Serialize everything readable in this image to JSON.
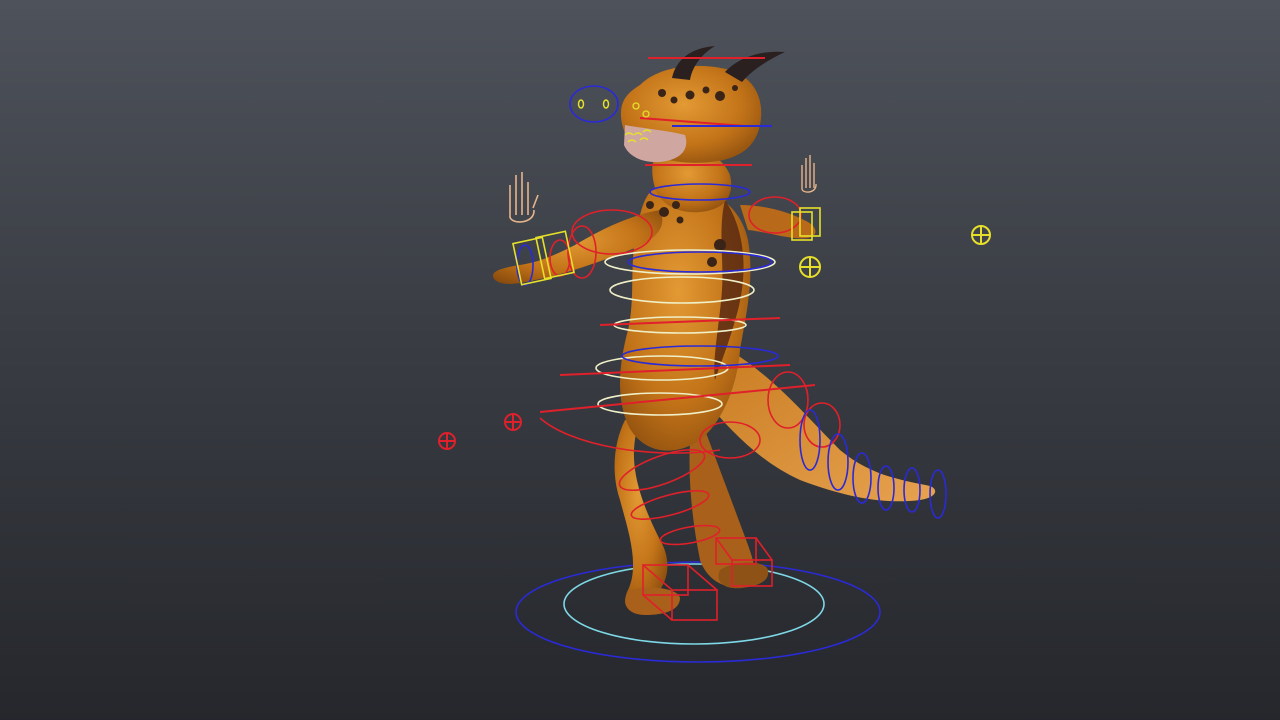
{
  "viewport": {
    "background_top": "#4e525a",
    "background_bottom": "#25272c"
  },
  "character": {
    "skin_color": "#c97a1c",
    "spot_color": "#3a2418",
    "horn_color": "#2a2020",
    "snout_color": "#cfa7a0"
  },
  "rig_colors": {
    "fk_controls": "#e0202a",
    "ik_controls": "#2a2ad8",
    "spine_controls": "#f0f0c8",
    "handles": "#e6e02a",
    "root_inner": "#7ed8e6",
    "hand_icons": "#e6b48c"
  },
  "icons": {
    "left_hand": "hand-icon",
    "right_hand": "hand-icon",
    "pole_vector": "locator-icon"
  }
}
